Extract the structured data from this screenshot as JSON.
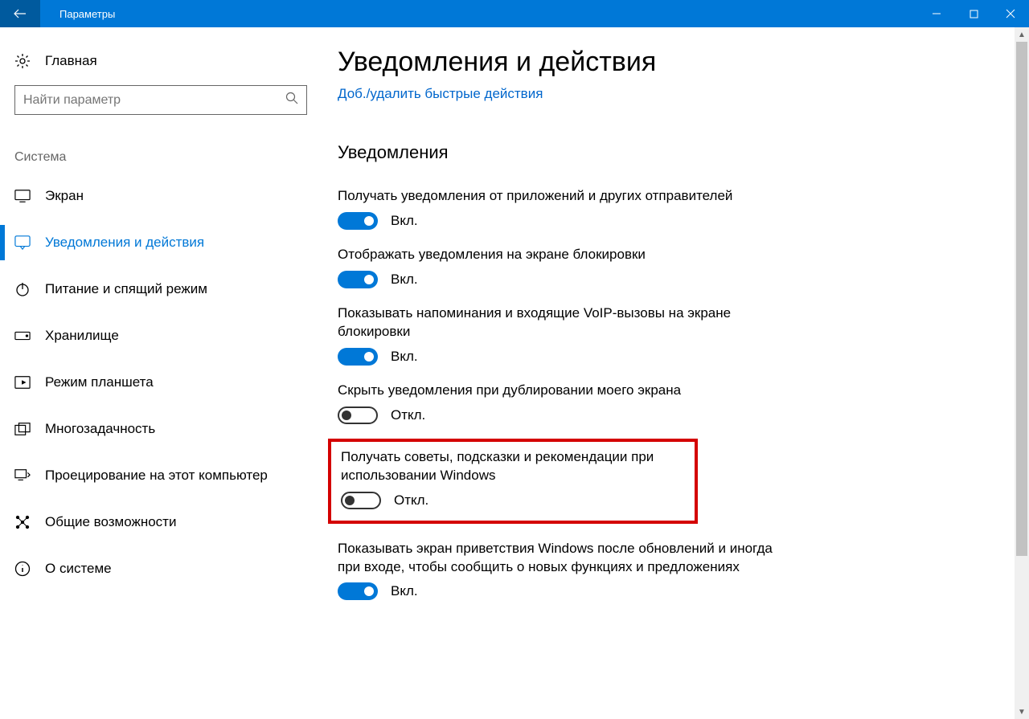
{
  "titlebar": {
    "title": "Параметры"
  },
  "sidebar": {
    "home": "Главная",
    "search_placeholder": "Найти параметр",
    "group": "Система",
    "items": [
      {
        "label": "Экран",
        "icon": "display"
      },
      {
        "label": "Уведомления и действия",
        "icon": "notification",
        "active": true
      },
      {
        "label": "Питание и спящий режим",
        "icon": "power"
      },
      {
        "label": "Хранилище",
        "icon": "storage"
      },
      {
        "label": "Режим планшета",
        "icon": "tablet"
      },
      {
        "label": "Многозадачность",
        "icon": "multitask"
      },
      {
        "label": "Проецирование на этот компьютер",
        "icon": "project"
      },
      {
        "label": "Общие возможности",
        "icon": "share"
      },
      {
        "label": "О системе",
        "icon": "info"
      }
    ]
  },
  "main": {
    "title": "Уведомления и действия",
    "quick_link": "Доб./удалить быстрые действия",
    "section": "Уведомления",
    "state_on": "Вкл.",
    "state_off": "Откл.",
    "settings": [
      {
        "label": "Получать уведомления от приложений и других отправителей",
        "on": true
      },
      {
        "label": "Отображать уведомления на экране блокировки",
        "on": true
      },
      {
        "label": "Показывать напоминания и входящие VoIP-вызовы на экране блокировки",
        "on": true
      },
      {
        "label": "Скрыть уведомления при дублировании моего экрана",
        "on": false
      },
      {
        "label": "Получать советы, подсказки и рекомендации при использовании Windows",
        "on": false,
        "highlight": true
      },
      {
        "label": "Показывать экран приветствия Windows после обновлений и иногда при входе, чтобы сообщить о новых функциях и предложениях",
        "on": true
      }
    ]
  }
}
